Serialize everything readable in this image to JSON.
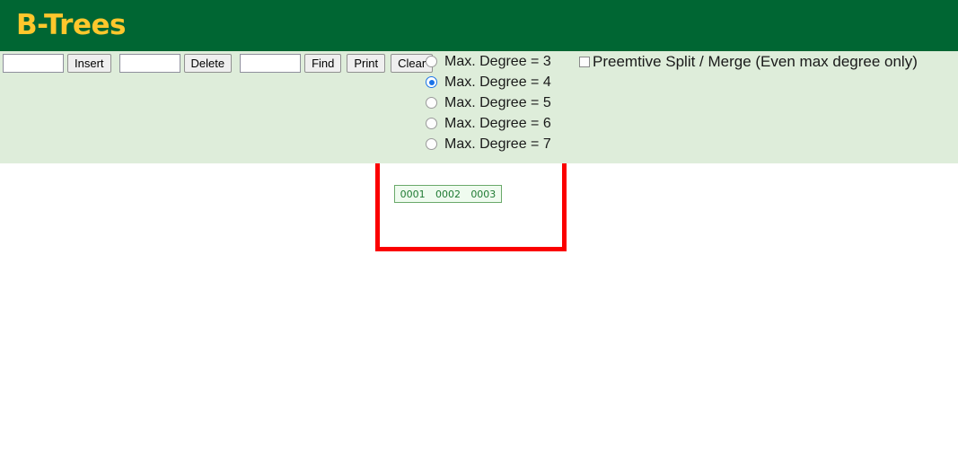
{
  "header": {
    "title": "B-Trees",
    "background_color": "#006633",
    "title_color": "#ffc72c"
  },
  "toolbar": {
    "insert_value": "",
    "insert_placeholder": "",
    "insert_label": "Insert",
    "delete_value": "",
    "delete_placeholder": "",
    "delete_label": "Delete",
    "find_value": "",
    "find_placeholder": "",
    "find_label": "Find",
    "print_label": "Print",
    "clear_label": "Clear"
  },
  "degree_options": [
    {
      "label": "Max. Degree = 3",
      "selected": false
    },
    {
      "label": "Max. Degree = 4",
      "selected": true
    },
    {
      "label": "Max. Degree = 5",
      "selected": false
    },
    {
      "label": "Max. Degree = 6",
      "selected": false
    },
    {
      "label": "Max. Degree = 7",
      "selected": false
    }
  ],
  "preemptive": {
    "label": "Preemtive Split / Merge (Even max degree only)",
    "checked": false
  },
  "canvas": {
    "panel_color": "#deedda",
    "background_color": "#ffffff",
    "highlight_color": "#fb0000",
    "node_border_color": "#6aa96a",
    "node_fill_color": "#effbef",
    "node_text_color": "#1f7a33",
    "nodes": [
      {
        "keys": [
          "0001",
          "0002",
          "0003"
        ]
      }
    ]
  }
}
